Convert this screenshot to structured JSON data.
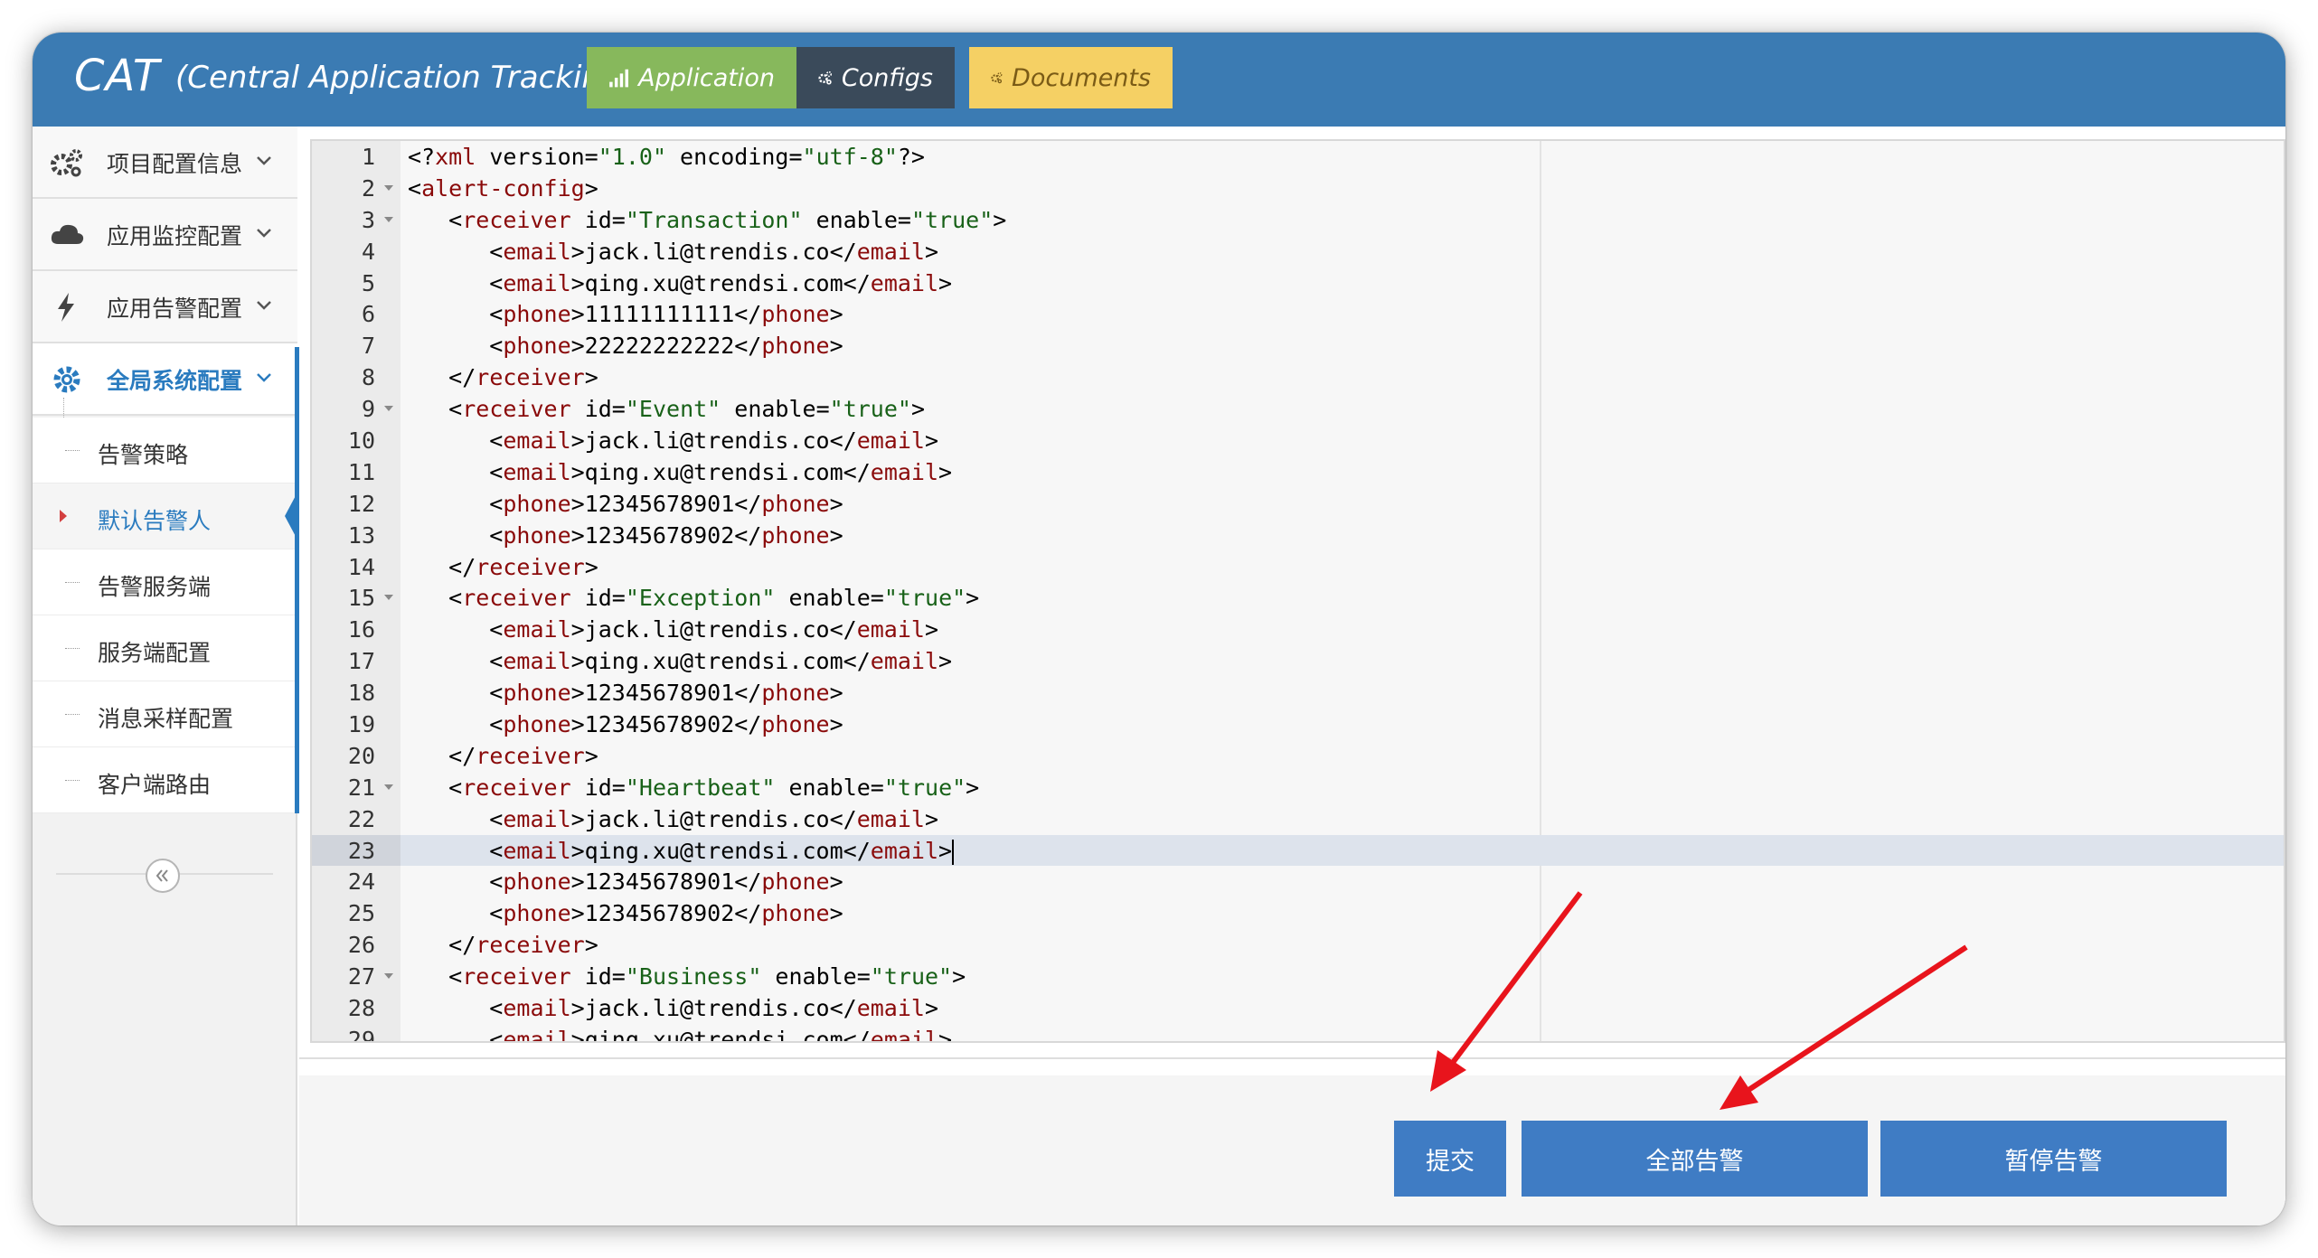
{
  "header": {
    "brand": "CAT",
    "brand_subtitle": "(Central Application Tracking)",
    "nav": [
      {
        "label": "Application",
        "icon": "bar-chart-icon",
        "color": "#87b85c"
      },
      {
        "label": "Configs",
        "icon": "gears-icon",
        "color": "#3a4a5a"
      },
      {
        "label": "Documents",
        "icon": "gears-icon",
        "color": "#f5d064"
      }
    ]
  },
  "sidebar": {
    "groups": [
      {
        "label": "项目配置信息",
        "icon": "gears-icon"
      },
      {
        "label": "应用监控配置",
        "icon": "cloud-icon"
      },
      {
        "label": "应用告警配置",
        "icon": "bolt-icon"
      },
      {
        "label": "全局系统配置",
        "icon": "gear-icon",
        "active": true
      }
    ],
    "sub_items": [
      {
        "label": "告警策略"
      },
      {
        "label": "默认告警人",
        "active": true
      },
      {
        "label": "告警服务端"
      },
      {
        "label": "服务端配置"
      },
      {
        "label": "消息采样配置"
      },
      {
        "label": "客户端路由"
      }
    ]
  },
  "editor": {
    "active_line": 23,
    "lines": [
      "<?xml version=\"1.0\" encoding=\"utf-8\"?>",
      "<alert-config>",
      "   <receiver id=\"Transaction\" enable=\"true\">",
      "      <email>jack.li@trendis.co</email>",
      "      <email>qing.xu@trendsi.com</email>",
      "      <phone>11111111111</phone>",
      "      <phone>22222222222</phone>",
      "   </receiver>",
      "   <receiver id=\"Event\" enable=\"true\">",
      "      <email>jack.li@trendis.co</email>",
      "      <email>qing.xu@trendsi.com</email>",
      "      <phone>12345678901</phone>",
      "      <phone>12345678902</phone>",
      "   </receiver>",
      "   <receiver id=\"Exception\" enable=\"true\">",
      "      <email>jack.li@trendis.co</email>",
      "      <email>qing.xu@trendsi.com</email>",
      "      <phone>12345678901</phone>",
      "      <phone>12345678902</phone>",
      "   </receiver>",
      "   <receiver id=\"Heartbeat\" enable=\"true\">",
      "      <email>jack.li@trendis.co</email>",
      "      <email>qing.xu@trendsi.com</email>",
      "      <phone>12345678901</phone>",
      "      <phone>12345678902</phone>",
      "   </receiver>",
      "   <receiver id=\"Business\" enable=\"true\">",
      "      <email>jack.li@trendis.co</email>",
      "      <email>qing.xu@trendsi.com</email>"
    ],
    "fold_lines": [
      2,
      3,
      9,
      15,
      21,
      27
    ]
  },
  "actions": {
    "submit": "提交",
    "alert_all": "全部告警",
    "pause": "暂停告警"
  },
  "colors": {
    "header": "#3b7bb3",
    "accent": "#2a7bbf",
    "button": "#3f7cc4",
    "annotation_arrow": "#e8141c"
  }
}
